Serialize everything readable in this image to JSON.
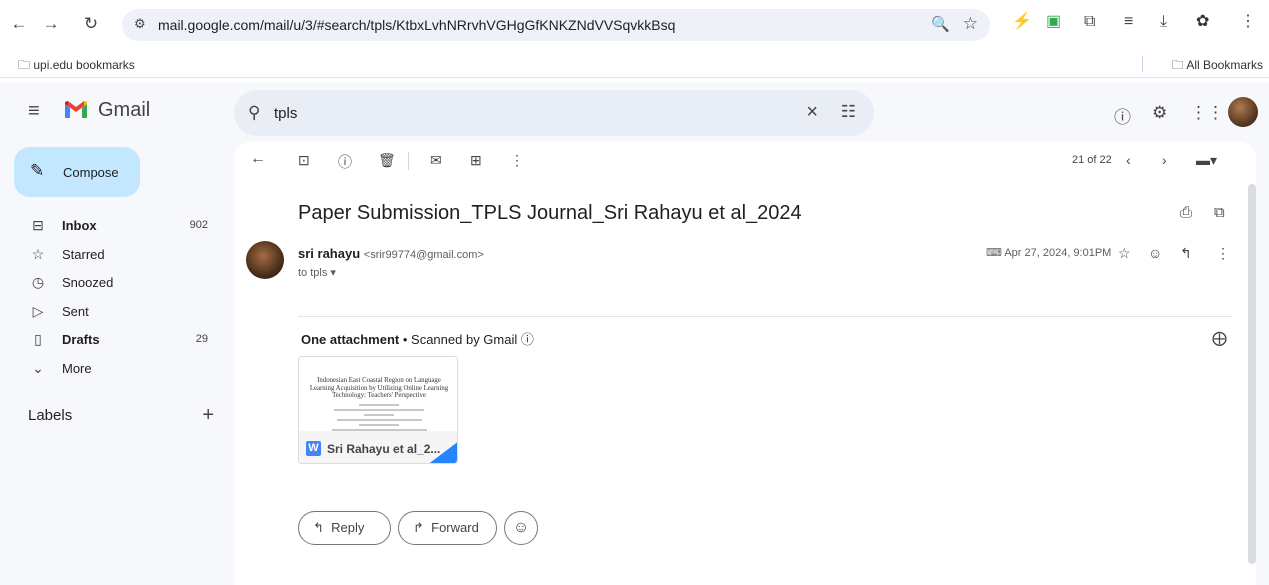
{
  "browser": {
    "url": "mail.google.com/mail/u/3/#search/tpls/KtbxLvhNRrvhVGHgGfKNKZNdVVSqvkkBsq",
    "bookmarks_left": "upi.edu bookmarks",
    "bookmarks_right": "All Bookmarks"
  },
  "header": {
    "app_name": "Gmail",
    "search_value": "tpls"
  },
  "sidebar": {
    "compose_label": "Compose",
    "items": [
      {
        "label": "Inbox",
        "count": "902",
        "icon": "inbox-icon",
        "bold": true
      },
      {
        "label": "Starred",
        "count": "",
        "icon": "star-icon",
        "bold": false
      },
      {
        "label": "Snoozed",
        "count": "",
        "icon": "clock-icon",
        "bold": false
      },
      {
        "label": "Sent",
        "count": "",
        "icon": "send-icon",
        "bold": false
      },
      {
        "label": "Drafts",
        "count": "29",
        "icon": "draft-icon",
        "bold": true
      },
      {
        "label": "More",
        "count": "",
        "icon": "chevron-down-icon",
        "bold": false
      }
    ],
    "labels_title": "Labels"
  },
  "message": {
    "pager": "21 of 22",
    "subject": "Paper Submission_TPLS Journal_Sri Rahayu et al_2024",
    "sender_name": "sri rahayu",
    "sender_email": "<srir99774@gmail.com>",
    "to": "to tpls",
    "date": "Apr 27, 2024, 9:01PM",
    "attachment_header": "One attachment",
    "scanned_text": "Scanned by Gmail",
    "attachment": {
      "doc_title": "Indonesian East Coastal Region on Language Learning Acquisition by Utilizing Online Learning Technology: Teachers' Perspective",
      "file_name": "Sri Rahayu et al_2..."
    },
    "reply_label": "Reply",
    "forward_label": "Forward"
  }
}
